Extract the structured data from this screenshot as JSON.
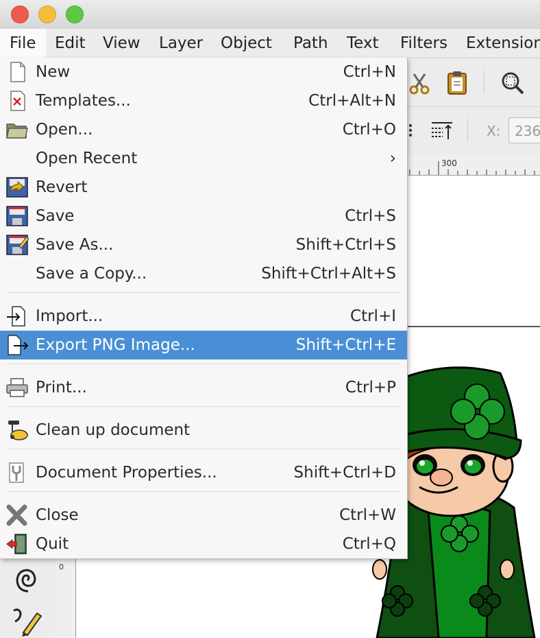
{
  "window": {
    "traffic_lights": {
      "close": "#ee5a52",
      "minimize": "#f4bd3b",
      "zoom": "#5ec843"
    }
  },
  "menubar": {
    "items": [
      "File",
      "Edit",
      "View",
      "Layer",
      "Object",
      "Path",
      "Text",
      "Filters",
      "Extension"
    ]
  },
  "file_menu": {
    "items": [
      {
        "label": "New",
        "shortcut": "Ctrl+N",
        "icon": "new-document-icon"
      },
      {
        "label": "Templates...",
        "shortcut": "Ctrl+Alt+N",
        "icon": "templates-icon"
      },
      {
        "label": "Open...",
        "shortcut": "Ctrl+O",
        "icon": "folder-open-icon"
      },
      {
        "label": "Open Recent",
        "shortcut": "›",
        "icon": ""
      },
      {
        "label": "Revert",
        "shortcut": "",
        "icon": "revert-icon"
      },
      {
        "label": "Save",
        "shortcut": "Ctrl+S",
        "icon": "save-icon"
      },
      {
        "label": "Save As...",
        "shortcut": "Shift+Ctrl+S",
        "icon": "save-as-icon"
      },
      {
        "label": "Save a Copy...",
        "shortcut": "Shift+Ctrl+Alt+S",
        "icon": ""
      },
      {
        "label": "Import...",
        "shortcut": "Ctrl+I",
        "icon": "import-icon"
      },
      {
        "label": "Export PNG Image...",
        "shortcut": "Shift+Ctrl+E",
        "icon": "export-png-icon",
        "highlighted": true
      },
      {
        "label": "Print...",
        "shortcut": "Ctrl+P",
        "icon": "printer-icon"
      },
      {
        "label": "Clean up document",
        "shortcut": "",
        "icon": "vacuum-icon"
      },
      {
        "label": "Document Properties...",
        "shortcut": "Shift+Ctrl+D",
        "icon": "document-properties-icon"
      },
      {
        "label": "Close",
        "shortcut": "Ctrl+W",
        "icon": "close-x-icon"
      },
      {
        "label": "Quit",
        "shortcut": "Ctrl+Q",
        "icon": "quit-door-icon"
      }
    ]
  },
  "toolbar": {
    "x_label": "X:",
    "x_value": "236"
  },
  "ruler": {
    "h_tick": "300",
    "v_tick": "0"
  },
  "colors": {
    "highlight": "#4a8fd6",
    "leprechaun_green": "#0f6a12"
  }
}
